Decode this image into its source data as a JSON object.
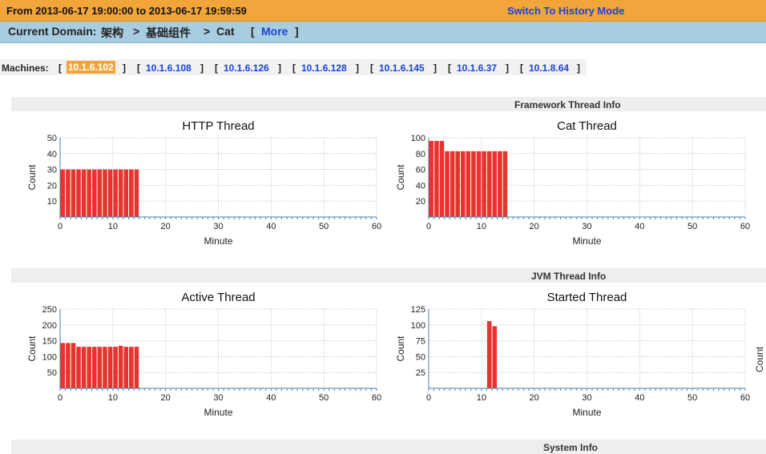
{
  "header": {
    "time_range": "From 2013-06-17 19:00:00 to 2013-06-17 19:59:59",
    "switch_label": "Switch To History Mode"
  },
  "domain": {
    "label": "Current Domain:",
    "path1": "架构",
    "sep1": ">",
    "path2": "基础组件",
    "sep2": ">",
    "path3": "Cat",
    "more_open": "[",
    "more_label": "More",
    "more_close": "]"
  },
  "machines": {
    "label": "Machines:",
    "items": [
      "10.1.6.102",
      "10.1.6.108",
      "10.1.6.126",
      "10.1.6.128",
      "10.1.6.145",
      "10.1.6.37",
      "10.1.8.64"
    ],
    "active": "10.1.6.102"
  },
  "sections": {
    "framework": "Framework Thread Info",
    "jvm": "JVM Thread Info",
    "system": "System Info"
  },
  "colors": {
    "bar": "#e8332e",
    "accent": "#f2a53a",
    "link": "#1a44d6"
  },
  "chart_data": [
    {
      "type": "bar",
      "title": "HTTP Thread",
      "xlabel": "Minute",
      "ylabel": "Count",
      "xlim": [
        0,
        60
      ],
      "ylim": [
        0,
        50
      ],
      "yticks": [
        10,
        20,
        30,
        40,
        50
      ],
      "xticks": [
        0,
        10,
        20,
        30,
        40,
        50,
        60
      ],
      "x": [
        0,
        1,
        2,
        3,
        4,
        5,
        6,
        7,
        8,
        9,
        10,
        11,
        12,
        13,
        14
      ],
      "values": [
        30,
        30,
        30,
        30,
        30,
        30,
        30,
        30,
        30,
        30,
        30,
        30,
        30,
        30,
        30
      ]
    },
    {
      "type": "bar",
      "title": "Cat Thread",
      "xlabel": "Minute",
      "ylabel": "Count",
      "xlim": [
        0,
        60
      ],
      "ylim": [
        0,
        100
      ],
      "yticks": [
        20,
        40,
        60,
        80,
        100
      ],
      "xticks": [
        0,
        10,
        20,
        30,
        40,
        50,
        60
      ],
      "x": [
        0,
        1,
        2,
        3,
        4,
        5,
        6,
        7,
        8,
        9,
        10,
        11,
        12,
        13,
        14
      ],
      "values": [
        96,
        96,
        96,
        83,
        83,
        83,
        83,
        83,
        83,
        83,
        83,
        83,
        83,
        83,
        83
      ]
    },
    {
      "type": "bar",
      "title": "Active Thread",
      "xlabel": "Minute",
      "ylabel": "Count",
      "xlim": [
        0,
        60
      ],
      "ylim": [
        0,
        250
      ],
      "yticks": [
        50,
        100,
        150,
        200,
        250
      ],
      "xticks": [
        0,
        10,
        20,
        30,
        40,
        50,
        60
      ],
      "x": [
        0,
        1,
        2,
        3,
        4,
        5,
        6,
        7,
        8,
        9,
        10,
        11,
        12,
        13,
        14
      ],
      "values": [
        143,
        143,
        143,
        131,
        131,
        131,
        131,
        131,
        131,
        131,
        131,
        134,
        131,
        131,
        131
      ]
    },
    {
      "type": "bar",
      "title": "Started Thread",
      "xlabel": "Minute",
      "ylabel": "Count",
      "xlim": [
        0,
        60
      ],
      "ylim": [
        0,
        125
      ],
      "yticks": [
        25,
        50,
        75,
        100,
        125
      ],
      "xticks": [
        0,
        10,
        20,
        30,
        40,
        50,
        60
      ],
      "x": [
        11,
        12
      ],
      "values": [
        106,
        98
      ]
    }
  ]
}
